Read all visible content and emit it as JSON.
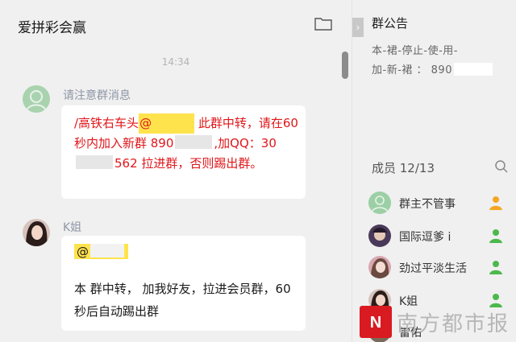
{
  "chat": {
    "title": "爱拼彩会赢",
    "timestamp": "14:34",
    "messages": [
      {
        "sender": "请注意群消息",
        "prefix": "/高铁右车头",
        "mention": "@",
        "text_1": "此群中转，请在60秒内加入新群 890",
        "text_2": ",加QQ：30",
        "text_3": "562 拉进群，否则踢出群。"
      },
      {
        "sender": "K姐",
        "mention": "@",
        "text": "本 群中转， 加我好友，拉进会员群，60秒后自动踢出群"
      }
    ]
  },
  "side": {
    "collapse_glyph": "›",
    "notice_title": "群公告",
    "notice_line_1": "本-裙-停止-使-用-",
    "notice_line_2": "加-新-裙 ： 890",
    "members_label": "成员 12/13",
    "members": [
      {
        "name": "群主不管事",
        "badge": "owner",
        "avatar_color": "#9ccfa5"
      },
      {
        "name": "国际逗爹 i",
        "badge": "member",
        "avatar_color": "#4a3a5a"
      },
      {
        "name": "劲过平淡生活",
        "badge": "member",
        "avatar_color": "#d8a8b0"
      },
      {
        "name": "K姐",
        "badge": "member",
        "avatar_color": "#2a2a2a"
      },
      {
        "name": "雷佑",
        "badge": "member",
        "avatar_color": "#7a6a5a"
      }
    ]
  },
  "watermark": {
    "logo_text": "N",
    "text": "南方都市报"
  },
  "colors": {
    "mention_bg": "#ffe34d",
    "notice_red": "#e0161a",
    "owner_badge": "#f5a623",
    "member_badge": "#4cb84c",
    "sender_gray": "#8e97a6"
  }
}
